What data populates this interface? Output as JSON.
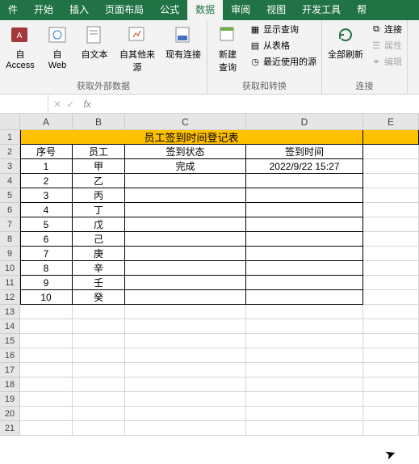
{
  "tabs": {
    "file": "件",
    "home": "开始",
    "insert": "插入",
    "layout": "页面布局",
    "formula": "公式",
    "data": "数据",
    "review": "审阅",
    "view": "视图",
    "dev": "开发工具",
    "help": "帮"
  },
  "ribbon": {
    "access": "自\nAccess",
    "web": "自\nWeb",
    "text": "自文本",
    "other": "自其他来源",
    "existing": "现有连接",
    "group1": "获取外部数据",
    "newquery": "新建\n查询",
    "showquery": "显示查询",
    "fromtable": "从表格",
    "recent": "最近使用的源",
    "group2": "获取和转换",
    "refresh": "全部刷新",
    "connections": "连接",
    "properties": "属性",
    "editlinks": "编辑",
    "group3": "连接"
  },
  "namebox": "",
  "fx": "fx",
  "columns": {
    "A": "A",
    "B": "B",
    "C": "C",
    "D": "D",
    "E": "E"
  },
  "title": "员工签到时间登记表",
  "headers": {
    "seq": "序号",
    "emp": "员工",
    "status": "签到状态",
    "time": "签到时间"
  },
  "rows": [
    {
      "seq": "1",
      "emp": "甲",
      "status": "完成",
      "time": "2022/9/22 15:27"
    },
    {
      "seq": "2",
      "emp": "乙",
      "status": "",
      "time": ""
    },
    {
      "seq": "3",
      "emp": "丙",
      "status": "",
      "time": ""
    },
    {
      "seq": "4",
      "emp": "丁",
      "status": "",
      "time": ""
    },
    {
      "seq": "5",
      "emp": "戊",
      "status": "",
      "time": ""
    },
    {
      "seq": "6",
      "emp": "己",
      "status": "",
      "time": ""
    },
    {
      "seq": "7",
      "emp": "庚",
      "status": "",
      "time": ""
    },
    {
      "seq": "8",
      "emp": "辛",
      "status": "",
      "time": ""
    },
    {
      "seq": "9",
      "emp": "壬",
      "status": "",
      "time": ""
    },
    {
      "seq": "10",
      "emp": "癸",
      "status": "",
      "time": ""
    }
  ],
  "rownums": [
    "1",
    "2",
    "3",
    "4",
    "5",
    "6",
    "7",
    "8",
    "9",
    "10",
    "11",
    "12",
    "13",
    "14",
    "15",
    "16",
    "17",
    "18",
    "19",
    "20",
    "21"
  ]
}
